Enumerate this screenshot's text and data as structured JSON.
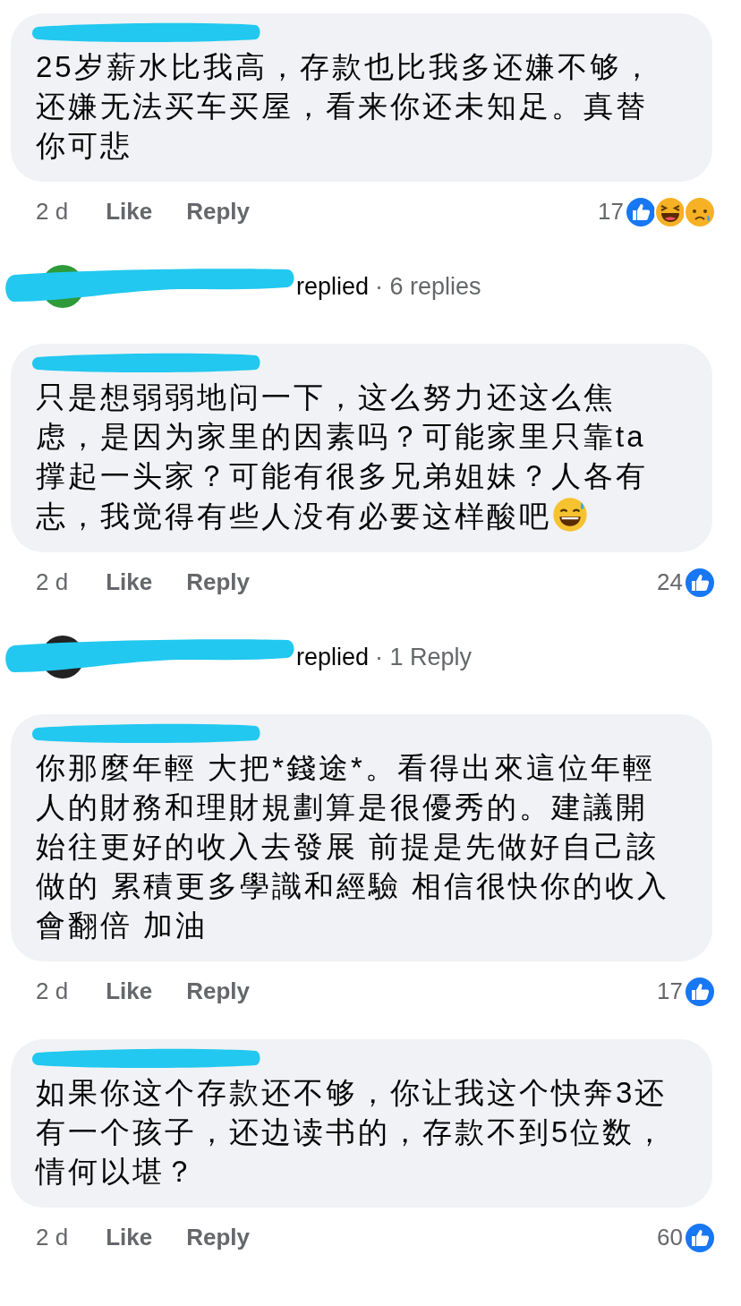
{
  "items": [
    {
      "kind": "comment",
      "text": "25岁薪水比我高，存款也比我多还嫌不够，还嫌无法买车买屋，看来你还未知足。真替你可悲",
      "time": "2 d",
      "like": "Like",
      "reply": "Reply",
      "count": "17",
      "reactions": [
        {
          "kind": "like"
        },
        {
          "kind": "haha"
        },
        {
          "kind": "sad"
        }
      ]
    },
    {
      "kind": "replies",
      "color": "#2e9a3a",
      "verb": "replied",
      "summary": "· 6 replies"
    },
    {
      "kind": "comment",
      "text": "只是想弱弱地问一下，这么努力还这么焦虑，是因为家里的因素吗？可能家里只靠ta撑起一头家？可能有很多兄弟姐妹？人各有志，我觉得有些人没有必要这样酸吧",
      "trailing_icon": {
        "kind": "sweat-smile"
      },
      "time": "2 d",
      "like": "Like",
      "reply": "Reply",
      "count": "24",
      "reactions": [
        {
          "kind": "like"
        }
      ]
    },
    {
      "kind": "replies",
      "color": "#222222",
      "verb": "replied",
      "summary": "· 1 Reply"
    },
    {
      "kind": "comment",
      "text": "你那麼年輕 大把*錢途*。看得出來這位年輕人的財務和理財規劃算是很優秀的。建議開始往更好的收入去發展 前提是先做好自己該做的 累積更多學識和經驗 相信很快你的收入會翻倍 加油",
      "time": "2 d",
      "like": "Like",
      "reply": "Reply",
      "count": "17",
      "reactions": [
        {
          "kind": "like"
        }
      ]
    },
    {
      "kind": "comment",
      "text": "如果你这个存款还不够，你让我这个快奔3还有一个孩子，还边读书的，存款不到5位数，情何以堪？",
      "time": "2 d",
      "like": "Like",
      "reply": "Reply",
      "count": "60",
      "reactions": [
        {
          "kind": "like"
        }
      ]
    }
  ]
}
